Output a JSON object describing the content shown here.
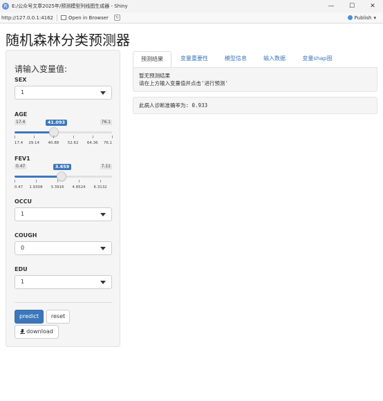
{
  "window": {
    "title": "E:/公众号文章2025年/预测模型列线图生成器 - Shiny",
    "url": "http://127.0.0.1:4162",
    "open_in_browser": "Open in Browser",
    "publish": "Publish"
  },
  "app": {
    "title": "随机森林分类预测器"
  },
  "sidebar": {
    "heading": "请输入变量值:",
    "sex": {
      "label": "SEX",
      "value": "1"
    },
    "age": {
      "label": "AGE",
      "min": "17.4",
      "max": "76.1",
      "value": "41.093",
      "value_fraction": 0.4037,
      "ticks": [
        "17.4",
        "29.14",
        "40.88",
        "52.62",
        "64.36",
        "76.1"
      ]
    },
    "fev1": {
      "label": "FEV1",
      "min": "0.47",
      "max": "7.11",
      "value": "3.659",
      "value_fraction": 0.4803,
      "ticks": [
        "0.47",
        "1.9308",
        "3.3916",
        "4.8524",
        "6.3132"
      ]
    },
    "occu": {
      "label": "OCCU",
      "value": "1"
    },
    "cough": {
      "label": "COUGH",
      "value": "0"
    },
    "edu": {
      "label": "EDU",
      "value": "1"
    },
    "predict_label": "predict",
    "reset_label": "reset",
    "download_label": "download"
  },
  "tabs": [
    "预测结果",
    "变量重要性",
    "模型信息",
    "输入数据",
    "变量shap图"
  ],
  "main": {
    "result_line1": "暂无预测结果",
    "result_line2": "请在上方输入变量值并点击'进行预测'",
    "accuracy": "此病人诊断准确率为: 0.933"
  },
  "colors": {
    "primary": "#3d77bb"
  }
}
